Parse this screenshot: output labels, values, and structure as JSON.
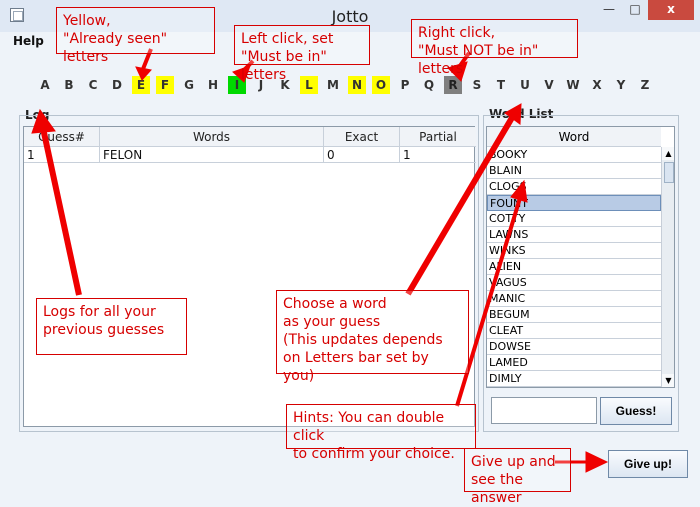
{
  "window": {
    "title": "Jotto",
    "buttons": {
      "minimize": "—",
      "maximize": "□",
      "close": "x"
    }
  },
  "menu": {
    "help": "Help"
  },
  "letters": [
    {
      "text": "A",
      "state": "normal"
    },
    {
      "text": "B",
      "state": "normal"
    },
    {
      "text": "C",
      "state": "normal"
    },
    {
      "text": "D",
      "state": "normal"
    },
    {
      "text": "E",
      "state": "seen"
    },
    {
      "text": "F",
      "state": "seen"
    },
    {
      "text": "G",
      "state": "normal"
    },
    {
      "text": "H",
      "state": "normal"
    },
    {
      "text": "I",
      "state": "must"
    },
    {
      "text": "J",
      "state": "normal"
    },
    {
      "text": "K",
      "state": "normal"
    },
    {
      "text": "L",
      "state": "seen"
    },
    {
      "text": "M",
      "state": "normal"
    },
    {
      "text": "N",
      "state": "seen"
    },
    {
      "text": "O",
      "state": "seen"
    },
    {
      "text": "P",
      "state": "normal"
    },
    {
      "text": "Q",
      "state": "normal"
    },
    {
      "text": "R",
      "state": "mustnot"
    },
    {
      "text": "S",
      "state": "normal"
    },
    {
      "text": "T",
      "state": "normal"
    },
    {
      "text": "U",
      "state": "normal"
    },
    {
      "text": "V",
      "state": "normal"
    },
    {
      "text": "W",
      "state": "normal"
    },
    {
      "text": "X",
      "state": "normal"
    },
    {
      "text": "Y",
      "state": "normal"
    },
    {
      "text": "Z",
      "state": "normal"
    }
  ],
  "log": {
    "title": "Log",
    "columns": [
      "Guess#",
      "Words",
      "Exact",
      "Partial"
    ],
    "rows": [
      {
        "guess": "1",
        "word": "FELON",
        "exact": "0",
        "partial": "1"
      }
    ]
  },
  "word_list": {
    "title": "Word List",
    "column": "Word",
    "items": [
      "BOOKY",
      "BLAIN",
      "CLOGS",
      "FOUNT",
      "COTTY",
      "LAWNS",
      "WINKS",
      "ALIEN",
      "VAGUS",
      "MANIC",
      "BEGUM",
      "CLEAT",
      "DOWSE",
      "LAMED",
      "DIMLY"
    ],
    "selected": "FOUNT"
  },
  "controls": {
    "guess_input_value": "",
    "guess_button": "Guess!",
    "giveup_button": "Give up!"
  },
  "annotations": {
    "yellow": "Yellow,\n\"Already seen\" letters",
    "left_click": "Left click, set\n\"Must be in\" letters",
    "right_click": "Right click,\n\"Must NOT be in\" letters",
    "logs": "Logs for all your\nprevious guesses",
    "choose": "Choose a word\nas your guess\n(This updates depends\non Letters bar set by you)",
    "hints": "Hints: You can double click\nto confirm your choice.",
    "giveup": "Give up and\nsee the answer"
  },
  "colors": {
    "seen": "#ffff00",
    "must": "#00d900",
    "mustnot": "#7f7f7f",
    "annotation": "#d60000"
  }
}
